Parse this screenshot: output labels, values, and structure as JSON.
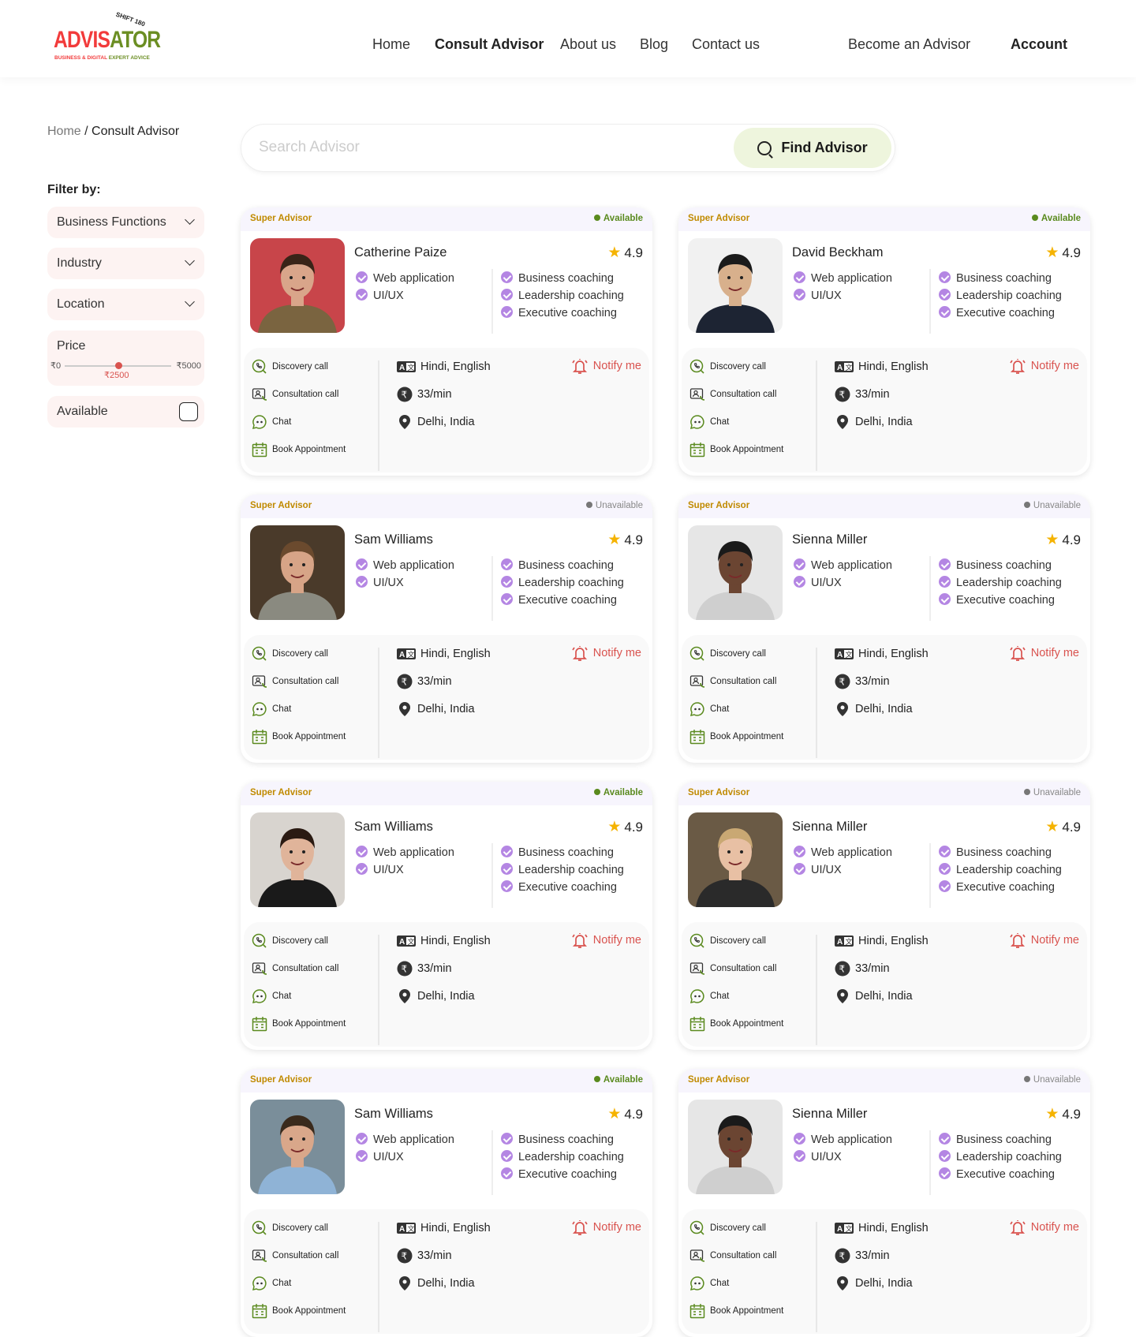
{
  "logo": {
    "text_a": "ADVIS",
    "text_b": "ATOR",
    "arc": "SHIFT 180",
    "tag_a": "BUSINESS & DIGITAL",
    "tag_b": "EXPERT ADVICE"
  },
  "nav": {
    "home": "Home",
    "consult": "Consult Advisor",
    "about": "About us",
    "blog": "Blog",
    "contact": "Contact us",
    "become": "Become an Advisor",
    "account": "Account"
  },
  "breadcrumb": {
    "home": "Home",
    "sep": " / ",
    "current": "Consult Advisor"
  },
  "filters": {
    "title": "Filter by:",
    "business": "Business Functions",
    "industry": "Industry",
    "location": "Location",
    "price": {
      "label": "Price",
      "min": "₹0",
      "max": "₹5000",
      "value": "₹2500",
      "fraction": 0.5
    },
    "available": "Available"
  },
  "search": {
    "placeholder": "Search Advisor",
    "button": "Find Advisor"
  },
  "card_labels": {
    "super": "Super Advisor",
    "discovery": "Discovery call",
    "consultation": "Consultation call",
    "chat": "Chat",
    "book": "Book Appointment",
    "notify": "Notify me"
  },
  "colors": {
    "accent_green": "#5a8a1e",
    "notify_red": "#d9534f",
    "check_purple": "#b486e3",
    "super_gold": "#c08a00"
  },
  "advisors": [
    {
      "name": "Catherine Paize",
      "rating": "4.9",
      "status": "Available",
      "available": true,
      "skills_left": [
        "Web application",
        "UI/UX"
      ],
      "skills_right": [
        "Business coaching",
        "Leadership coaching",
        "Executive coaching"
      ],
      "languages": "Hindi, English",
      "rate": "33/min",
      "location": "Delhi, India",
      "bg": "#c8454a",
      "skin": "#d9a58a",
      "hair": "#3a2418",
      "cloth": "#7a6440"
    },
    {
      "name": "David Beckham",
      "rating": "4.9",
      "status": "Available",
      "available": true,
      "skills_left": [
        "Web application",
        "UI/UX"
      ],
      "skills_right": [
        "Business coaching",
        "Leadership coaching",
        "Executive coaching"
      ],
      "languages": "Hindi, English",
      "rate": "33/min",
      "location": "Delhi, India",
      "bg": "#f1f1f1",
      "skin": "#d8b08c",
      "hair": "#1b1b1b",
      "cloth": "#1d2433"
    },
    {
      "name": "Sam Williams",
      "rating": "4.9",
      "status": "Unavailable",
      "available": false,
      "skills_left": [
        "Web application",
        "UI/UX"
      ],
      "skills_right": [
        "Business coaching",
        "Leadership coaching",
        "Executive coaching"
      ],
      "languages": "Hindi, English",
      "rate": "33/min",
      "location": "Delhi, India",
      "bg": "#4a3a2a",
      "skin": "#d7a487",
      "hair": "#6b4a2e",
      "cloth": "#8a8a80"
    },
    {
      "name": "Sienna Miller",
      "rating": "4.9",
      "status": "Unavailable",
      "available": false,
      "skills_left": [
        "Web application",
        "UI/UX"
      ],
      "skills_right": [
        "Business coaching",
        "Leadership coaching",
        "Executive coaching"
      ],
      "languages": "Hindi, English",
      "rate": "33/min",
      "location": "Delhi, India",
      "bg": "#e6e6e6",
      "skin": "#6b4532",
      "hair": "#1a1a1a",
      "cloth": "#cfcfcf"
    },
    {
      "name": "Sam Williams",
      "rating": "4.9",
      "status": "Available",
      "available": true,
      "skills_left": [
        "Web application",
        "UI/UX"
      ],
      "skills_right": [
        "Business coaching",
        "Leadership coaching",
        "Executive coaching"
      ],
      "languages": "Hindi, English",
      "rate": "33/min",
      "location": "Delhi, India",
      "bg": "#d8d4cf",
      "skin": "#e0b49a",
      "hair": "#2a1a12",
      "cloth": "#1a1a1a"
    },
    {
      "name": "Sienna Miller",
      "rating": "4.9",
      "status": "Unavailable",
      "available": false,
      "skills_left": [
        "Web application",
        "UI/UX"
      ],
      "skills_right": [
        "Business coaching",
        "Leadership coaching",
        "Executive coaching"
      ],
      "languages": "Hindi, English",
      "rate": "33/min",
      "location": "Delhi, India",
      "bg": "#6a5a45",
      "skin": "#e8c0a4",
      "hair": "#c9a873",
      "cloth": "#2a2a2a"
    },
    {
      "name": "Sam Williams",
      "rating": "4.9",
      "status": "Available",
      "available": true,
      "skills_left": [
        "Web application",
        "UI/UX"
      ],
      "skills_right": [
        "Business coaching",
        "Leadership coaching",
        "Executive coaching"
      ],
      "languages": "Hindi, English",
      "rate": "33/min",
      "location": "Delhi, India",
      "bg": "#7a8e9a",
      "skin": "#d9a78a",
      "hair": "#3a2a1c",
      "cloth": "#8fb3d6"
    },
    {
      "name": "Sienna Miller",
      "rating": "4.9",
      "status": "Unavailable",
      "available": false,
      "skills_left": [
        "Web application",
        "UI/UX"
      ],
      "skills_right": [
        "Business coaching",
        "Leadership coaching",
        "Executive coaching"
      ],
      "languages": "Hindi, English",
      "rate": "33/min",
      "location": "Delhi, India",
      "bg": "#e6e6e6",
      "skin": "#6b4532",
      "hair": "#1a1a1a",
      "cloth": "#cfcfcf"
    }
  ]
}
